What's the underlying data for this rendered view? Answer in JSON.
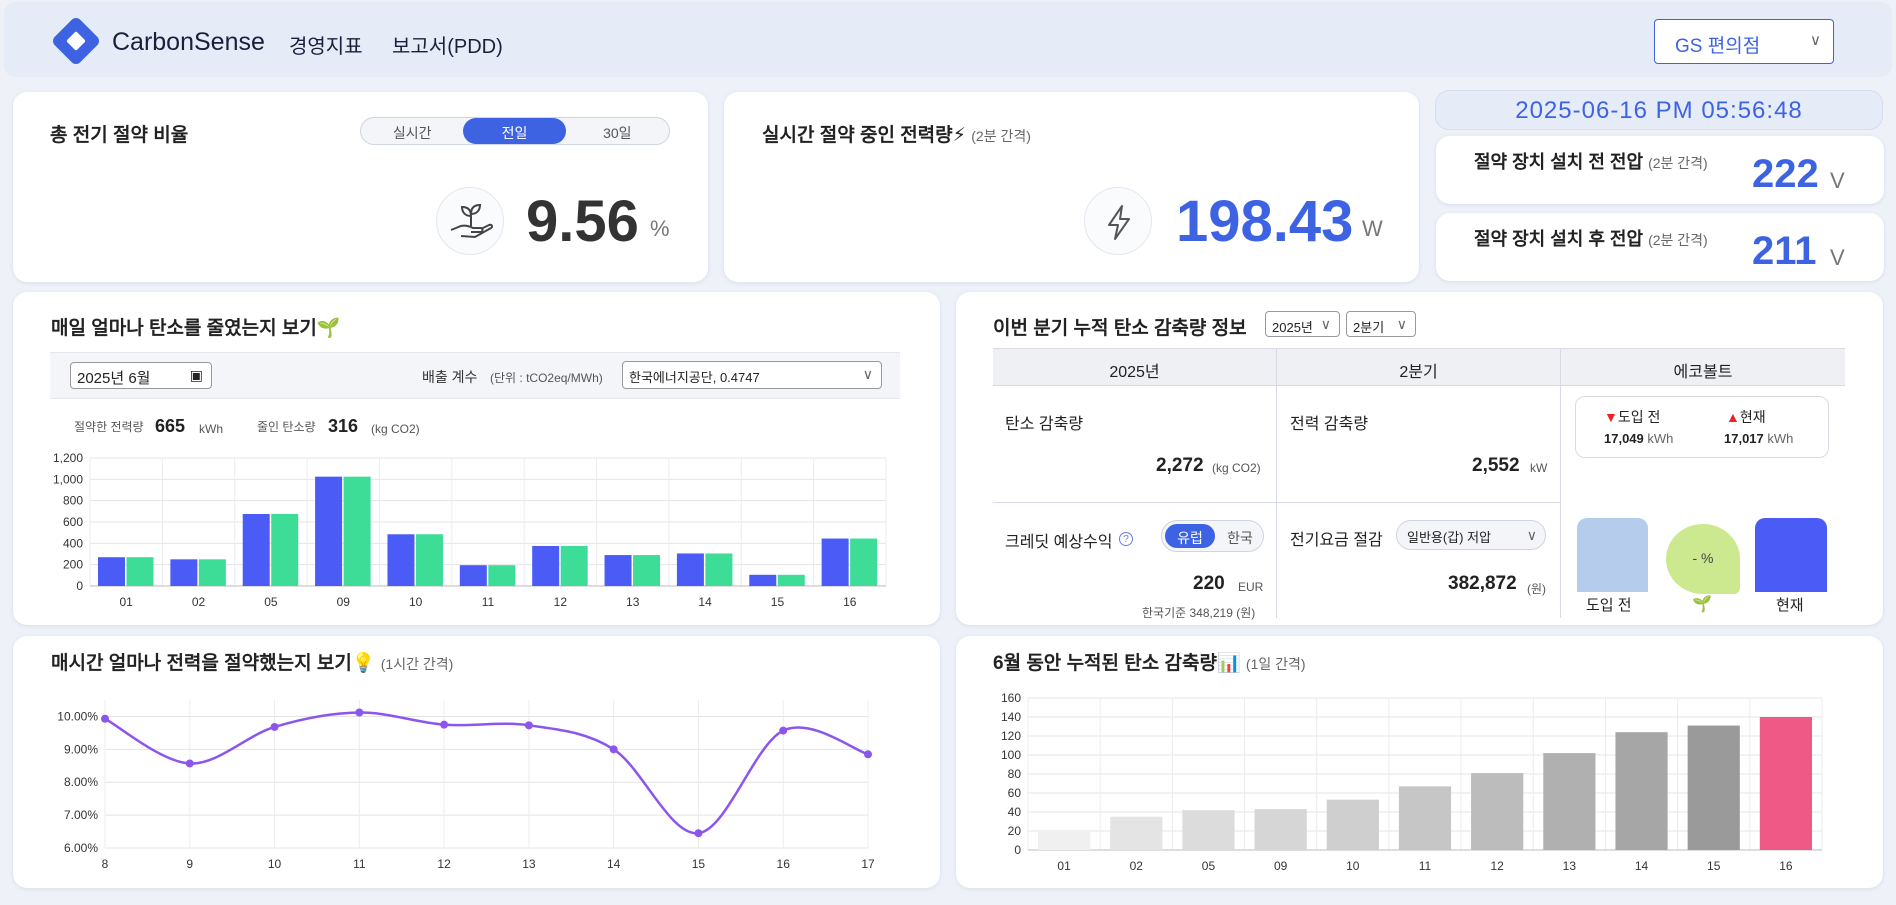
{
  "header": {
    "brand": "CarbonSense",
    "nav": [
      "경영지표",
      "보고서(PDD)"
    ],
    "store": "GS 편의점"
  },
  "ratio": {
    "title": "총 전기 절약 비율",
    "tabs": [
      "실시간",
      "전일",
      "30일"
    ],
    "active_tab": "전일",
    "value": "9.56",
    "unit": "%"
  },
  "realtime": {
    "title": "실시간 절약 중인 전력량⚡",
    "sub": "(2분 간격)",
    "value": "198.43",
    "unit": "W"
  },
  "clock": "2025-06-16 PM 05:56:48",
  "volt_before": {
    "label": "절약 장치 설치 전 전압",
    "sub": "(2분 간격)",
    "value": "222",
    "unit": "V"
  },
  "volt_after": {
    "label": "절약 장치 설치 후 전압",
    "sub": "(2분 간격)",
    "value": "211",
    "unit": "V"
  },
  "daily": {
    "title": "매일 얼마나 탄소를 줄였는지 보기🌱",
    "date": "2025년 6월",
    "coef_label": "배출 계수",
    "coef_unit": "(단위 : tCO2eq/MWh)",
    "coef_select": "한국에너지공단, 0.4747",
    "saved_power_label": "절약한 전력량",
    "saved_power": "665",
    "saved_power_unit": "kWh",
    "saved_carbon_label": "줄인 탄소량",
    "saved_carbon": "316",
    "saved_carbon_unit": "(kg CO2)"
  },
  "quarter": {
    "title": "이번 분기 누적 탄소 감축량 정보",
    "year_sel": "2025년",
    "q_sel": "2분기",
    "cols": [
      "2025년",
      "2분기",
      "에코볼트"
    ],
    "carbon_label": "탄소 감축량",
    "carbon_value": "2,272",
    "carbon_unit": "(kg CO2)",
    "power_label": "전력 감축량",
    "power_value": "2,552",
    "power_unit": "kW",
    "credit_label": "크레딧 예상수익",
    "credit_toggle": [
      "유럽",
      "한국"
    ],
    "credit_value": "220",
    "credit_unit": "EUR",
    "credit_kr": "한국기준 348,219 (원)",
    "bill_label": "전기요금 절감",
    "bill_select": "일반용(갑) 저압",
    "bill_value": "382,872",
    "bill_unit": "(원)",
    "before_label": "도입 전",
    "before_value": "17,049",
    "now_label": "현재",
    "now_value": "17,017",
    "kwh": "kWh",
    "bar_before": "도입 전",
    "bar_now": "현재",
    "drop_text": "- %"
  },
  "hourly": {
    "title": "매시간 얼마나 전력을 절약했는지 보기💡",
    "sub": "(1시간 간격)"
  },
  "cumulative": {
    "title": "6월 동안 누적된 탄소 감축량📊",
    "sub": "(1일 간격)"
  },
  "colors": {
    "blue": "#4a5cf5",
    "green": "#3ddc97",
    "purple": "#8b55ee",
    "pink": "#ee5a85",
    "accent": "#3d63e3"
  },
  "chart_data": [
    {
      "type": "bar",
      "categories": [
        "01",
        "02",
        "05",
        "09",
        "10",
        "11",
        "12",
        "13",
        "14",
        "15",
        "16"
      ],
      "series": [
        {
          "values": [
            270,
            250,
            675,
            1025,
            485,
            195,
            375,
            290,
            305,
            105,
            445
          ]
        },
        {
          "values": [
            270,
            250,
            675,
            1025,
            485,
            195,
            375,
            290,
            305,
            105,
            445
          ]
        }
      ],
      "ylim": [
        0,
        1200
      ],
      "yticks": [
        "0",
        "200",
        "400",
        "600",
        "800",
        "1,000",
        "1,200"
      ]
    },
    {
      "type": "line",
      "x": [
        "8",
        "9",
        "10",
        "11",
        "12",
        "13",
        "14",
        "15",
        "16",
        "17"
      ],
      "values": [
        9.93,
        8.57,
        9.68,
        10.12,
        9.75,
        9.73,
        9.0,
        6.45,
        9.57,
        8.85
      ],
      "ylim": [
        6.0,
        10.5
      ],
      "yticks": [
        "6.00%",
        "7.00%",
        "8.00%",
        "9.00%",
        "10.00%"
      ]
    },
    {
      "type": "bar",
      "categories": [
        "01",
        "02",
        "05",
        "09",
        "10",
        "11",
        "12",
        "13",
        "14",
        "15",
        "16"
      ],
      "values": [
        19,
        35,
        42,
        43,
        53,
        67,
        81,
        102,
        124,
        131,
        140
      ],
      "ylim": [
        0,
        160
      ],
      "yticks": [
        "0",
        "20",
        "40",
        "60",
        "80",
        "100",
        "120",
        "140",
        "160"
      ]
    }
  ]
}
